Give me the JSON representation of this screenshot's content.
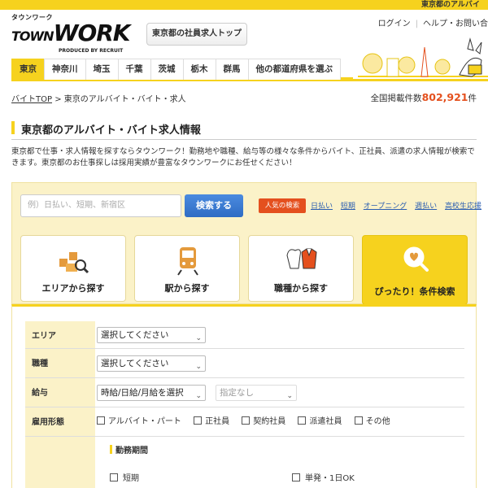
{
  "topbar": {
    "right_label": "東京都のアルバイ"
  },
  "header": {
    "logo_kana": "タウンワーク",
    "logo_town": "TOWN",
    "logo_work": "WORK",
    "logo_produced": "PRODUCED BY RECRUIT",
    "top_button": "東京都の社員求人トップ",
    "login": "ログイン",
    "help": "ヘルプ・お問い合"
  },
  "tabs": [
    {
      "label": "東京",
      "active": true
    },
    {
      "label": "神奈川"
    },
    {
      "label": "埼玉"
    },
    {
      "label": "千葉"
    },
    {
      "label": "茨城"
    },
    {
      "label": "栃木"
    },
    {
      "label": "群馬"
    },
    {
      "label": "他の都道府県を選ぶ"
    }
  ],
  "breadcrumb": {
    "home": "バイトTOP",
    "sep": ">",
    "current": "東京のアルバイト・バイト・求人"
  },
  "total": {
    "prefix": "全国掲載件数",
    "count": "802,921",
    "suffix": "件"
  },
  "page": {
    "title": "東京都のアルバイト・バイト求人情報",
    "description": "東京都で仕事・求人情報を探すならタウンワーク！勤務地や職種、給与等の様々な条件からバイト、正社員、派遣の求人情報が検索できます。東京都のお仕事探しは採用実績が豊富なタウンワークにお任せください！"
  },
  "search": {
    "placeholder": "例）日払い、短期、新宿区",
    "button": "検索する",
    "popular_label": "人気の検索",
    "popular": [
      "日払い",
      "短期",
      "オープニング",
      "週払い",
      "高校生応援"
    ]
  },
  "cards": [
    {
      "label": "エリアから探す",
      "icon": "map-icon"
    },
    {
      "label": "駅から探す",
      "icon": "train-icon"
    },
    {
      "label": "職種から探す",
      "icon": "uniform-icon"
    },
    {
      "label": "ぴったり！条件検索",
      "icon": "search-icon",
      "active": true
    }
  ],
  "form": {
    "area": {
      "label": "エリア",
      "value": "選択してください"
    },
    "job": {
      "label": "職種",
      "value": "選択してください"
    },
    "salary": {
      "label": "給与",
      "value": "時給/日給/月給を選択",
      "amount": "指定なし"
    },
    "employment": {
      "label": "雇用形態",
      "options": [
        "アルバイト・パート",
        "正社員",
        "契約社員",
        "派遣社員",
        "その他"
      ]
    },
    "period": {
      "title": "勤務期間",
      "options": [
        "短期",
        "単発・1日OK"
      ]
    }
  },
  "colors": {
    "brand_yellow": "#f6d21e",
    "accent_orange": "#e4501e",
    "link_blue": "#2a5db0",
    "button_blue": "#2f6cc4"
  }
}
